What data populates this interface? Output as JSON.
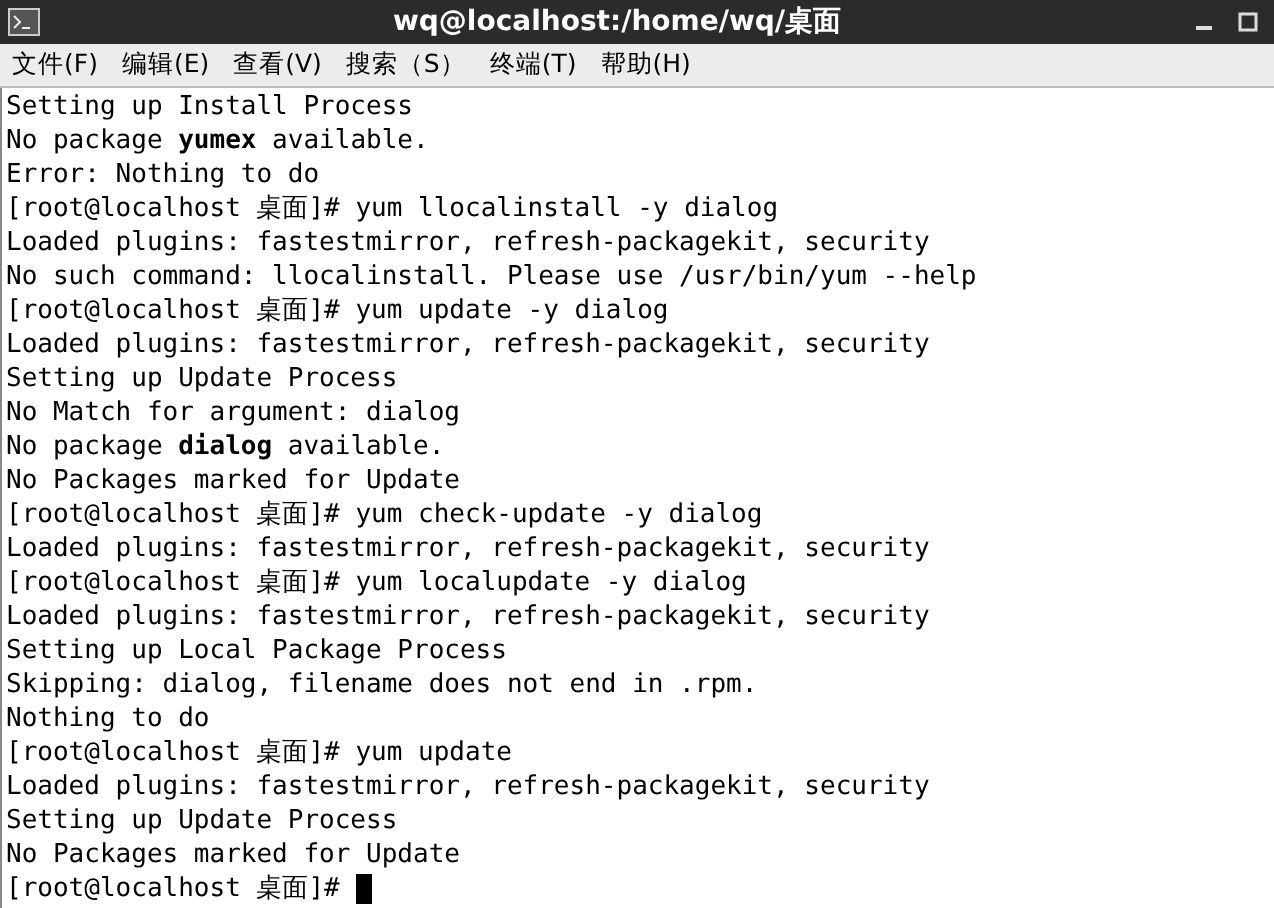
{
  "window": {
    "title": "wq@localhost:/home/wq/桌面"
  },
  "menu": [
    "文件(F)",
    "编辑(E)",
    "查看(V)",
    "搜索（S）",
    "终端(T)",
    "帮助(H)"
  ],
  "terminal": {
    "lines": [
      "Setting up Install Process",
      "No package **yumex** available.",
      "Error: Nothing to do",
      "[root@localhost 桌面]# yum llocalinstall -y dialog",
      "Loaded plugins: fastestmirror, refresh-packagekit, security",
      "No such command: llocalinstall. Please use /usr/bin/yum --help",
      "[root@localhost 桌面]# yum update -y dialog",
      "Loaded plugins: fastestmirror, refresh-packagekit, security",
      "Setting up Update Process",
      "No Match for argument: dialog",
      "No package **dialog** available.",
      "No Packages marked for Update",
      "[root@localhost 桌面]# yum check-update -y dialog",
      "Loaded plugins: fastestmirror, refresh-packagekit, security",
      "[root@localhost 桌面]# yum localupdate -y dialog",
      "Loaded plugins: fastestmirror, refresh-packagekit, security",
      "Setting up Local Package Process",
      "Skipping: dialog, filename does not end in .rpm.",
      "Nothing to do",
      "[root@localhost 桌面]# yum update",
      "Loaded plugins: fastestmirror, refresh-packagekit, security",
      "Setting up Update Process",
      "No Packages marked for Update",
      "[root@localhost 桌面]#"
    ],
    "cursor": true
  }
}
